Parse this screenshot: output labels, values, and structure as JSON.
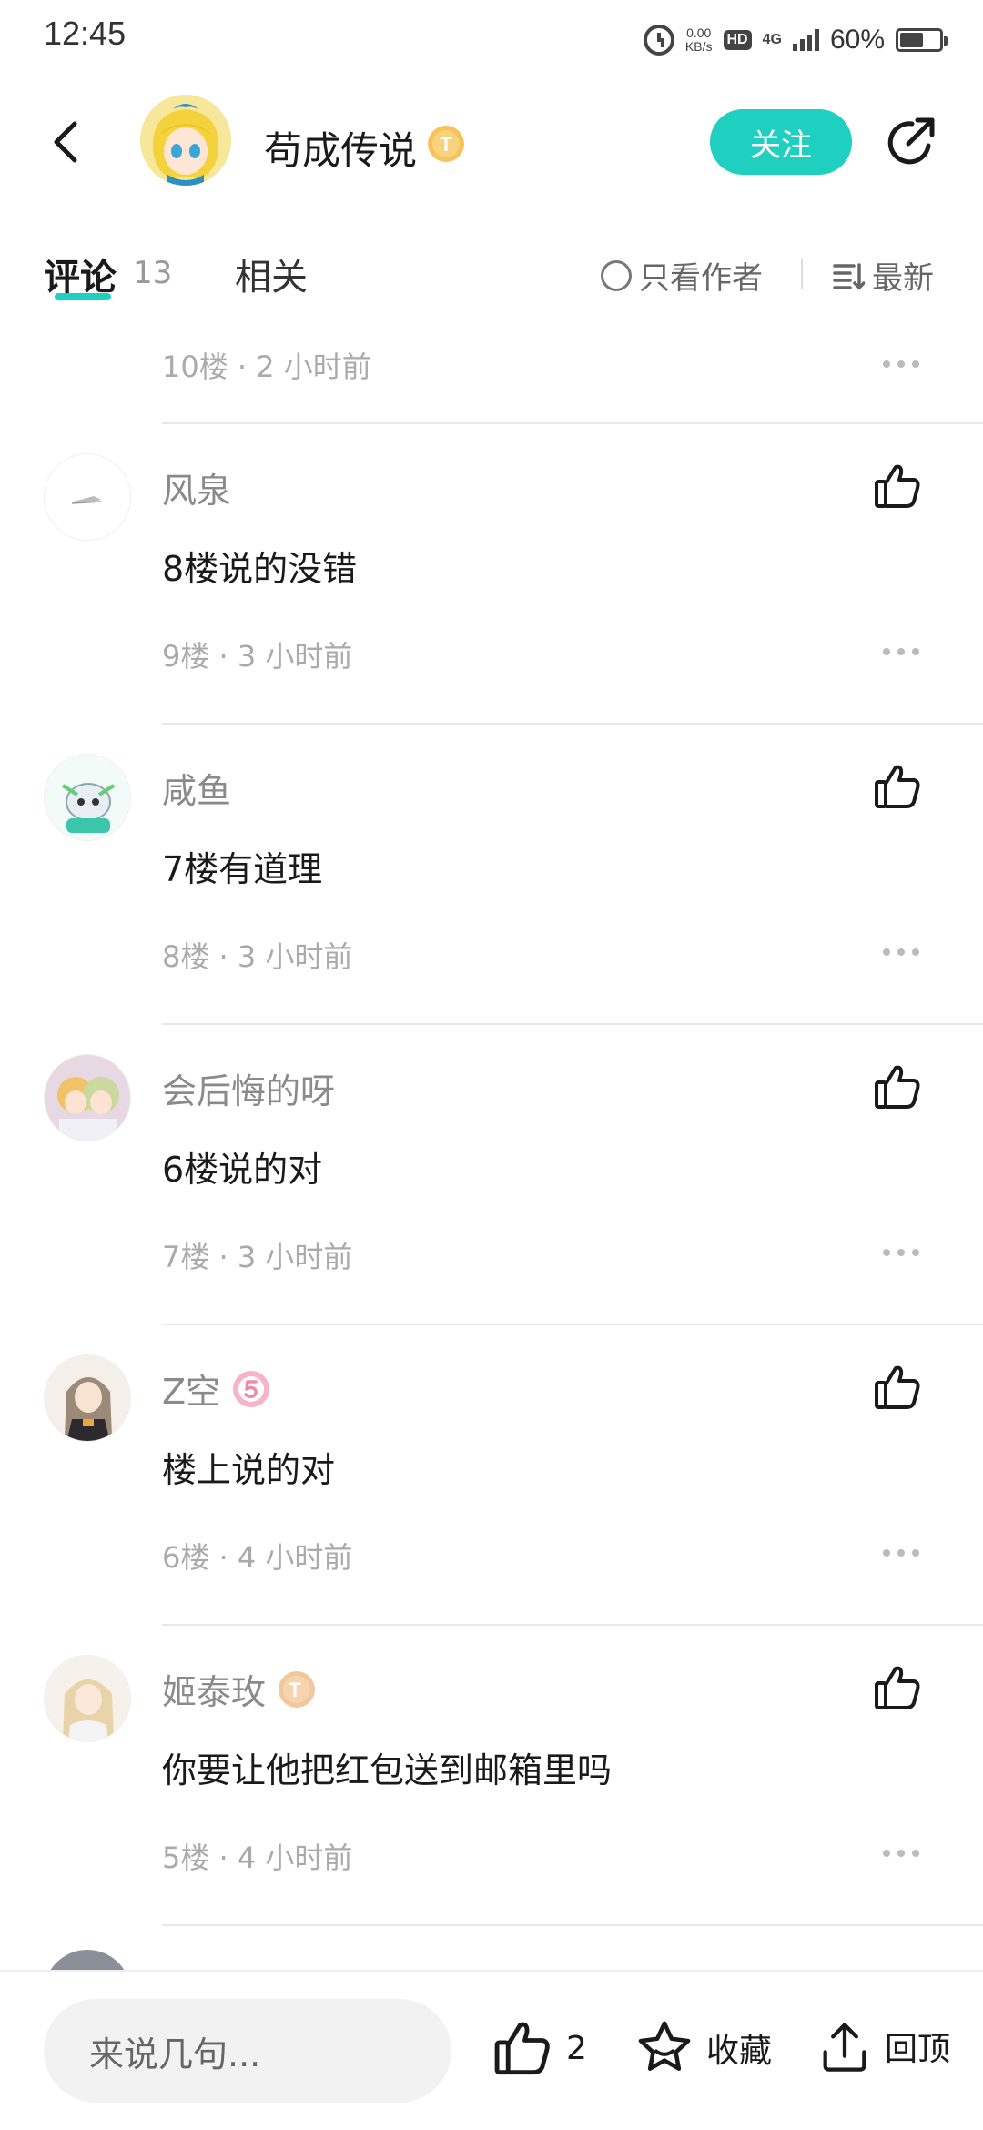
{
  "status_bar": {
    "time": "12:45",
    "speed_value": "0.00",
    "speed_unit": "KB/s",
    "hd": "HD",
    "network": "4G",
    "battery": "60%",
    "battery_level": 0.6
  },
  "header": {
    "author_name": "苟成传说",
    "badge_letter": "T",
    "follow_label": "关注"
  },
  "tabs": {
    "comments_label": "评论",
    "comments_count": "13",
    "related_label": "相关",
    "author_only_label": "只看作者",
    "sort_label": "最新"
  },
  "top_floor": {
    "meta": "10楼 · 2 小时前"
  },
  "comments": [
    {
      "name": "风泉",
      "text": "8楼说的没错",
      "meta": "9楼 · 3 小时前"
    },
    {
      "name": "咸鱼",
      "text": "7楼有道理",
      "meta": "8楼 · 3 小时前"
    },
    {
      "name": "会后悔的呀",
      "text": "6楼说的对",
      "meta": "7楼 · 3 小时前"
    },
    {
      "name": "Z空",
      "text": "楼上说的对",
      "meta": "6楼 · 4 小时前"
    },
    {
      "name": "姬泰玫",
      "text": "你要让他把红包送到邮箱里吗",
      "meta": "5楼 · 4 小时前"
    }
  ],
  "bottom_bar": {
    "input_placeholder": "来说几句...",
    "like_count": "2",
    "favorite_label": "收藏",
    "back_top_label": "回顶"
  },
  "colors": {
    "accent": "#1fcfbf",
    "text_primary": "#1a1a1a",
    "text_secondary": "#aaaaaa"
  }
}
